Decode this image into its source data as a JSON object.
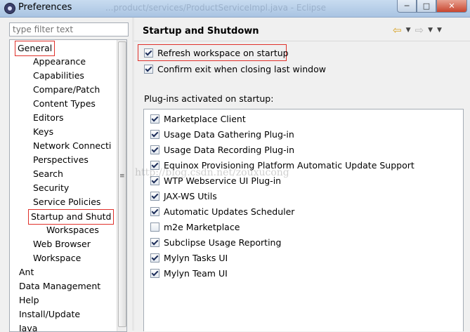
{
  "window": {
    "title": "Preferences",
    "ghost_title": "...product/services/ProductServiceImpl.java - Eclipse",
    "controls": {
      "minimize": "─",
      "maximize": "□",
      "close": "✕"
    }
  },
  "filter": {
    "placeholder": "type filter text"
  },
  "tree": {
    "items": [
      {
        "label": "General",
        "level": 1,
        "highlighted": true
      },
      {
        "label": "Appearance",
        "level": 2
      },
      {
        "label": "Capabilities",
        "level": 2
      },
      {
        "label": "Compare/Patch",
        "level": 2
      },
      {
        "label": "Content Types",
        "level": 2
      },
      {
        "label": "Editors",
        "level": 2
      },
      {
        "label": "Keys",
        "level": 2
      },
      {
        "label": "Network Connecti",
        "level": 2
      },
      {
        "label": "Perspectives",
        "level": 2
      },
      {
        "label": "Search",
        "level": 2
      },
      {
        "label": "Security",
        "level": 2
      },
      {
        "label": "Service Policies",
        "level": 2
      },
      {
        "label": "Startup and Shutd",
        "level": 2,
        "selected": true
      },
      {
        "label": "Workspaces",
        "level": 3
      },
      {
        "label": "Web Browser",
        "level": 2
      },
      {
        "label": "Workspace",
        "level": 2
      },
      {
        "label": "Ant",
        "level": 0
      },
      {
        "label": "Data Management",
        "level": 0
      },
      {
        "label": "Help",
        "level": 0
      },
      {
        "label": "Install/Update",
        "level": 0
      },
      {
        "label": "Java",
        "level": 0
      }
    ],
    "scroll_grip": "≡"
  },
  "page": {
    "title": "Startup and Shutdown",
    "nav": {
      "back": "⇦",
      "forward": "⇨",
      "dropdown": "▼",
      "menu": "▼"
    },
    "options": [
      {
        "label": "Refresh workspace on startup",
        "checked": true
      },
      {
        "label": "Confirm exit when closing last window",
        "checked": true
      }
    ],
    "plugins_label": "Plug-ins activated on startup:",
    "plugins": [
      {
        "label": "Marketplace Client",
        "checked": true
      },
      {
        "label": "Usage Data Gathering Plug-in",
        "checked": true
      },
      {
        "label": "Usage Data Recording Plug-in",
        "checked": true
      },
      {
        "label": "Equinox Provisioning Platform Automatic Update Support",
        "checked": true
      },
      {
        "label": "WTP Webservice UI Plug-in",
        "checked": true
      },
      {
        "label": "JAX-WS Utils",
        "checked": true
      },
      {
        "label": "Automatic Updates Scheduler",
        "checked": true
      },
      {
        "label": "m2e Marketplace",
        "checked": false
      },
      {
        "label": "Subclipse Usage Reporting",
        "checked": true
      },
      {
        "label": "Mylyn Tasks UI",
        "checked": true
      },
      {
        "label": "Mylyn Team UI",
        "checked": true
      }
    ]
  },
  "watermark": "http://blog.csdn.net/zouxucong"
}
